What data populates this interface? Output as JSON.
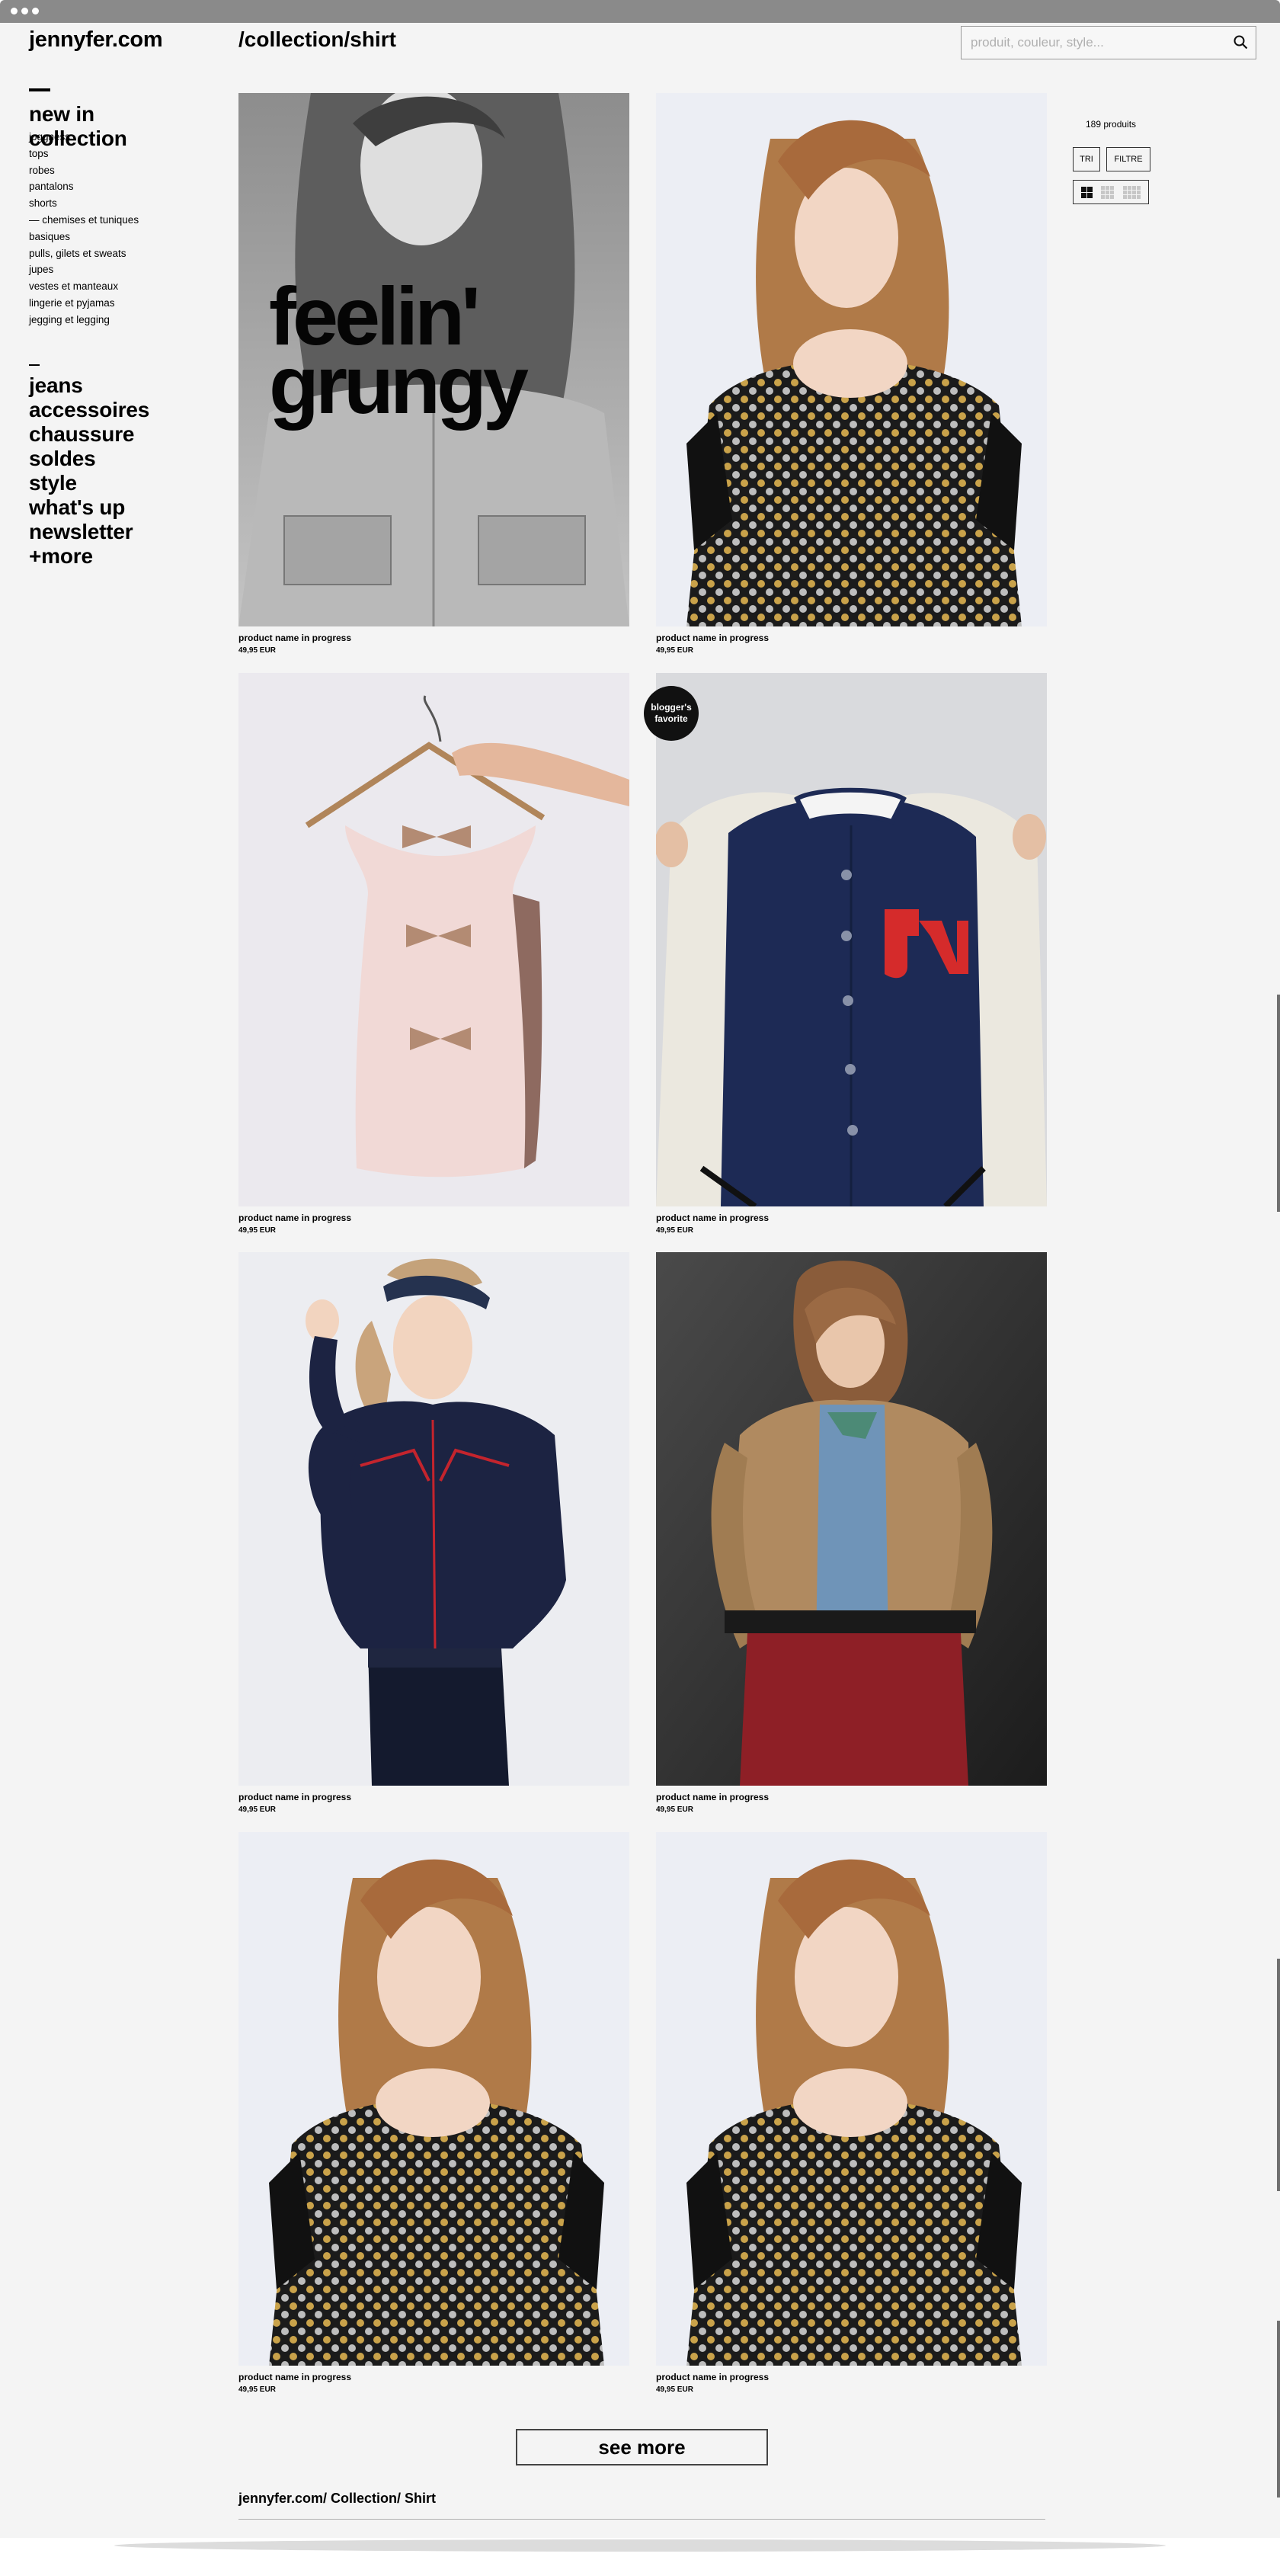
{
  "window": {
    "title_bar_icon": "traffic-dots"
  },
  "brand": {
    "logo": "jennyfer.com"
  },
  "nav": {
    "primary": [
      "new in",
      "collection"
    ],
    "sub": [
      "joggness",
      "tops",
      "robes",
      "pantalons",
      "shorts",
      "— chemises et tuniques",
      "basiques",
      "pulls, gilets et sweats",
      "jupes",
      "vestes et manteaux",
      "lingerie et pyjamas",
      "jegging et legging"
    ],
    "secondary": [
      "jeans",
      "accessoires",
      "chaussure",
      "soldes",
      "style",
      "what's up",
      "newsletter",
      "+more"
    ]
  },
  "header": {
    "breadcrumb": "/collection/shirt"
  },
  "search": {
    "placeholder": "produit, couleur, style...",
    "icon": "magnifier-icon"
  },
  "toolbar": {
    "count": "189 produits",
    "sort_label": "TRI",
    "filter_label": "FILTRE",
    "view_options": [
      "grid-2",
      "grid-3",
      "grid-4"
    ],
    "active_view": "grid-2"
  },
  "promo": {
    "line1": "feelin'",
    "line2": "grungy"
  },
  "badge": {
    "line1": "blogger's",
    "line2": "favorite"
  },
  "products": [
    {
      "name": "product name in progress",
      "price": "49,95 EUR",
      "image": "grunge-editorial-bw"
    },
    {
      "name": "product name in progress",
      "price": "49,95 EUR",
      "image": "studded-black-top"
    },
    {
      "name": "product name in progress",
      "price": "49,95 EUR",
      "image": "pink-bow-top-hanger"
    },
    {
      "name": "product name in progress",
      "price": "49,95 EUR",
      "image": "navy-varsity-jacket"
    },
    {
      "name": "product name in progress",
      "price": "49,95 EUR",
      "image": "navy-western-shirt"
    },
    {
      "name": "product name in progress",
      "price": "49,95 EUR",
      "image": "tan-jacket-denim-shirt"
    },
    {
      "name": "product name in progress",
      "price": "49,95 EUR",
      "image": "studded-black-top"
    },
    {
      "name": "product name in progress",
      "price": "49,95 EUR",
      "image": "studded-black-top"
    }
  ],
  "pagination": {
    "see_more_label": "see more"
  },
  "footer": {
    "breadcrumb": "jennyfer.com/ Collection/ Shirt"
  }
}
